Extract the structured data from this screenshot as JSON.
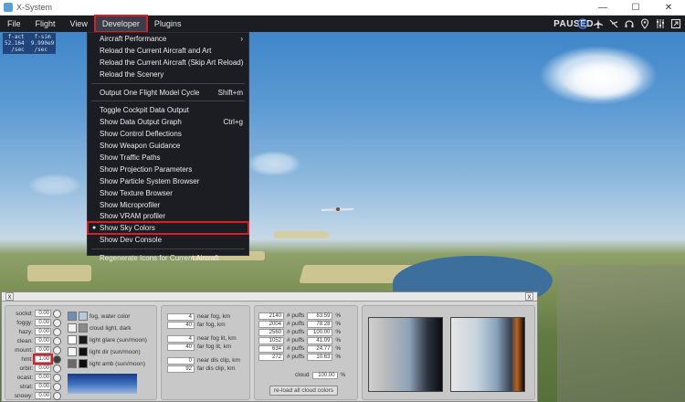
{
  "window": {
    "title": "X-System",
    "minimize": "—",
    "maximize": "☐",
    "close": "✕"
  },
  "menubar": {
    "items": [
      "File",
      "Flight",
      "View",
      "Developer",
      "Plugins"
    ],
    "status": "PAUSED"
  },
  "counters": {
    "line1": " f-act   f-sim",
    "line2": "52.164  9.990e9",
    "line3": "  /sec   /sec"
  },
  "developer_menu": {
    "items": [
      {
        "label": "Aircraft Performance",
        "shortcut": "",
        "submenu": true
      },
      {
        "label": "Reload the Current Aircraft and Art",
        "shortcut": ""
      },
      {
        "label": "Reload the Current Aircraft (Skip Art Reload)",
        "shortcut": ""
      },
      {
        "label": "Reload the Scenery",
        "shortcut": ""
      },
      {
        "label": "Output One Flight Model Cycle",
        "shortcut": "Shift+m"
      },
      {
        "label": "Toggle Cockpit Data Output",
        "shortcut": ""
      },
      {
        "label": "Show Data Output Graph",
        "shortcut": "Ctrl+g"
      },
      {
        "label": "Show Control Deflections",
        "shortcut": ""
      },
      {
        "label": "Show Weapon Guidance",
        "shortcut": ""
      },
      {
        "label": "Show Traffic Paths",
        "shortcut": ""
      },
      {
        "label": "Show Projection Parameters",
        "shortcut": ""
      },
      {
        "label": "Show Particle System Browser",
        "shortcut": ""
      },
      {
        "label": "Show Texture Browser",
        "shortcut": ""
      },
      {
        "label": "Show Microprofiler",
        "shortcut": ""
      },
      {
        "label": "Show VRAM profiler",
        "shortcut": ""
      },
      {
        "label": "Show Sky Colors",
        "shortcut": "",
        "checked": true
      },
      {
        "label": "Show Dev Console",
        "shortcut": ""
      },
      {
        "label": "Regenerate Icons for Current Aircraft",
        "shortcut": ""
      }
    ]
  },
  "sky_panel": {
    "close_left": "x",
    "close_right": "x",
    "sliders": [
      {
        "label": "sockd:",
        "value": "0.00"
      },
      {
        "label": "foggy:",
        "value": "0.00"
      },
      {
        "label": "hazy:",
        "value": "0.00"
      },
      {
        "label": "clean:",
        "value": "0.00"
      },
      {
        "label": "mount:",
        "value": "0.00"
      },
      {
        "label": "hmt:",
        "value": "1.00"
      },
      {
        "label": "orbit:",
        "value": "0.00"
      },
      {
        "label": "ocast:",
        "value": "0.00"
      },
      {
        "label": "strat:",
        "value": "0.00"
      },
      {
        "label": "snowy:",
        "value": "0.00"
      }
    ],
    "swatches": [
      {
        "label": "fog, water color",
        "color": "#6e8fb4",
        "color2": "#b7c9dc"
      },
      {
        "label": "cloud light, dark",
        "color": "#f2f2f2",
        "color2": "#8a8a8a"
      },
      {
        "label": "light glare (sun/moon)",
        "color": "#ffffff",
        "color2": "#1a1a1a"
      },
      {
        "label": "light dir (sun/moon)",
        "color": "#f6f6f6",
        "color2": "#111111"
      },
      {
        "label": "light amb (sun/moon)",
        "color": "#6a6a6a",
        "color2": "#0e0e0e"
      }
    ],
    "fog": [
      {
        "value": "4",
        "label": "near fog, km"
      },
      {
        "value": "40",
        "label": "far fog, km"
      },
      {
        "value": "4",
        "label": "near fog lit, km"
      },
      {
        "value": "40",
        "label": "far fog lit, km"
      },
      {
        "value": "0",
        "label": "near dis clip, km"
      },
      {
        "value": "92",
        "label": "far dis clip, km"
      }
    ],
    "puffs": [
      {
        "count": "2140",
        "label": "# puffs",
        "pct": "83.59",
        "unit": "%"
      },
      {
        "count": "2004",
        "label": "# puffs",
        "pct": "78.28",
        "unit": "%"
      },
      {
        "count": "2560",
        "label": "# puffs",
        "pct": "100.00",
        "unit": "%"
      },
      {
        "count": "1052",
        "label": "# puffs",
        "pct": "41.09",
        "unit": "%"
      },
      {
        "count": "634",
        "label": "# puffs",
        "pct": "24.77",
        "unit": "%"
      },
      {
        "count": "272",
        "label": "# puffs",
        "pct": "10.63",
        "unit": "%"
      }
    ],
    "cloud": {
      "label": "cloud",
      "value": "100.00",
      "unit": "%"
    },
    "reload_button": "re-load all cloud colors"
  }
}
